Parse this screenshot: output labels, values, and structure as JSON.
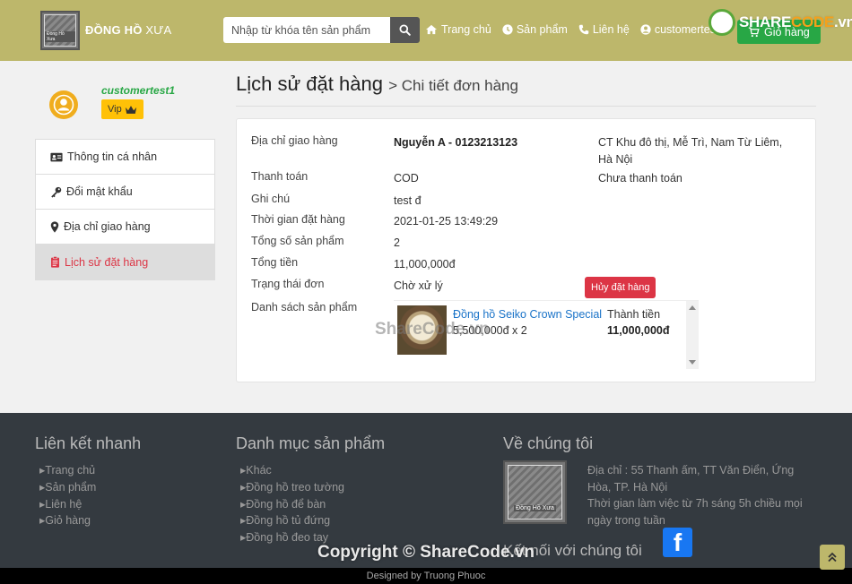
{
  "header": {
    "brand_strong": "ĐỒNG HỒ",
    "brand_light": " XƯA",
    "logo_text": "Đồng Hồ Xưa",
    "search_placeholder": "Nhập từ khóa tên sản phẩm",
    "nav": [
      {
        "label": "Trang chủ",
        "icon": "home-icon"
      },
      {
        "label": "Sản phẩm",
        "icon": "clock-icon"
      },
      {
        "label": "Liên hệ",
        "icon": "phone-icon"
      },
      {
        "label": "customertest1",
        "icon": "user-circle-icon"
      }
    ],
    "cart_label": "Giỏ hàng",
    "watermark_share": "SHARE",
    "watermark_code": "CODE",
    "watermark_tld": ".vn"
  },
  "sidebar": {
    "username": "customertest1",
    "badge": "Vip",
    "items": [
      {
        "label": "Thông tin cá nhân",
        "icon": "id-card-icon"
      },
      {
        "label": "Đổi mật khẩu",
        "icon": "key-icon"
      },
      {
        "label": "Địa chỉ giao hàng",
        "icon": "map-marker-icon"
      },
      {
        "label": "Lịch sử đặt hàng",
        "icon": "clipboard-icon"
      }
    ]
  },
  "main": {
    "title": "Lịch sử đặt hàng",
    "subtitle": "> Chi tiết đơn hàng",
    "labels": {
      "address": "Địa chỉ giao hàng",
      "payment": "Thanh toán",
      "note": "Ghi chú",
      "time": "Thời gian đặt hàng",
      "count": "Tổng số sản phẩm",
      "total": "Tổng tiền",
      "status": "Trạng thái đơn",
      "products": "Danh sách sản phẩm"
    },
    "values": {
      "recipient": "Nguyễn A - 0123213123",
      "address": "CT Khu đô thị, Mễ Trì, Nam Từ Liêm, Hà Nội",
      "payment": "COD",
      "payment_status": "Chưa thanh toán",
      "note": "test đ",
      "time": "2021-01-25 13:49:29",
      "count": "2",
      "total": "11,000,000đ",
      "status": "Chờ xử lý"
    },
    "cancel_label": "Hủy đặt hàng",
    "products": [
      {
        "name": "Đồng hồ Seiko Crown Special",
        "price_qty": "5,500,000đ x 2",
        "subtotal_label": "Thành tiền",
        "subtotal": "11,000,000đ"
      }
    ],
    "watermark": "ShareCode.vn"
  },
  "footer": {
    "quick_links_title": "Liên kết nhanh",
    "quick_links": [
      "Trang chủ",
      "Sản phẩm",
      "Liên hệ",
      "Giỏ hàng"
    ],
    "categories_title": "Danh mục sản phẩm",
    "categories": [
      "Khác",
      "Đồng hồ treo tường",
      "Đồng hồ để bàn",
      "Đồng hồ tủ đứng",
      "Đồng hồ đeo tay"
    ],
    "about_title": "Về chúng tôi",
    "address": "Địa chỉ : 55 Thanh ấm, TT Văn Điển, Ứng Hòa, TP. Hà Nội",
    "hours": "Thời gian làm việc từ 7h sáng 5h chiều mọi ngày trong tuần",
    "connect": "Kết nối với chúng tôi",
    "copyright": "Copyright © ShareCode.vn",
    "designed_by": "Designed by Truong Phuoc"
  },
  "colors": {
    "header_bg": "#bdb76b",
    "accent_green": "#28a745",
    "danger": "#dc3545",
    "vip": "#ffc107",
    "footer_bg": "#343a40"
  }
}
